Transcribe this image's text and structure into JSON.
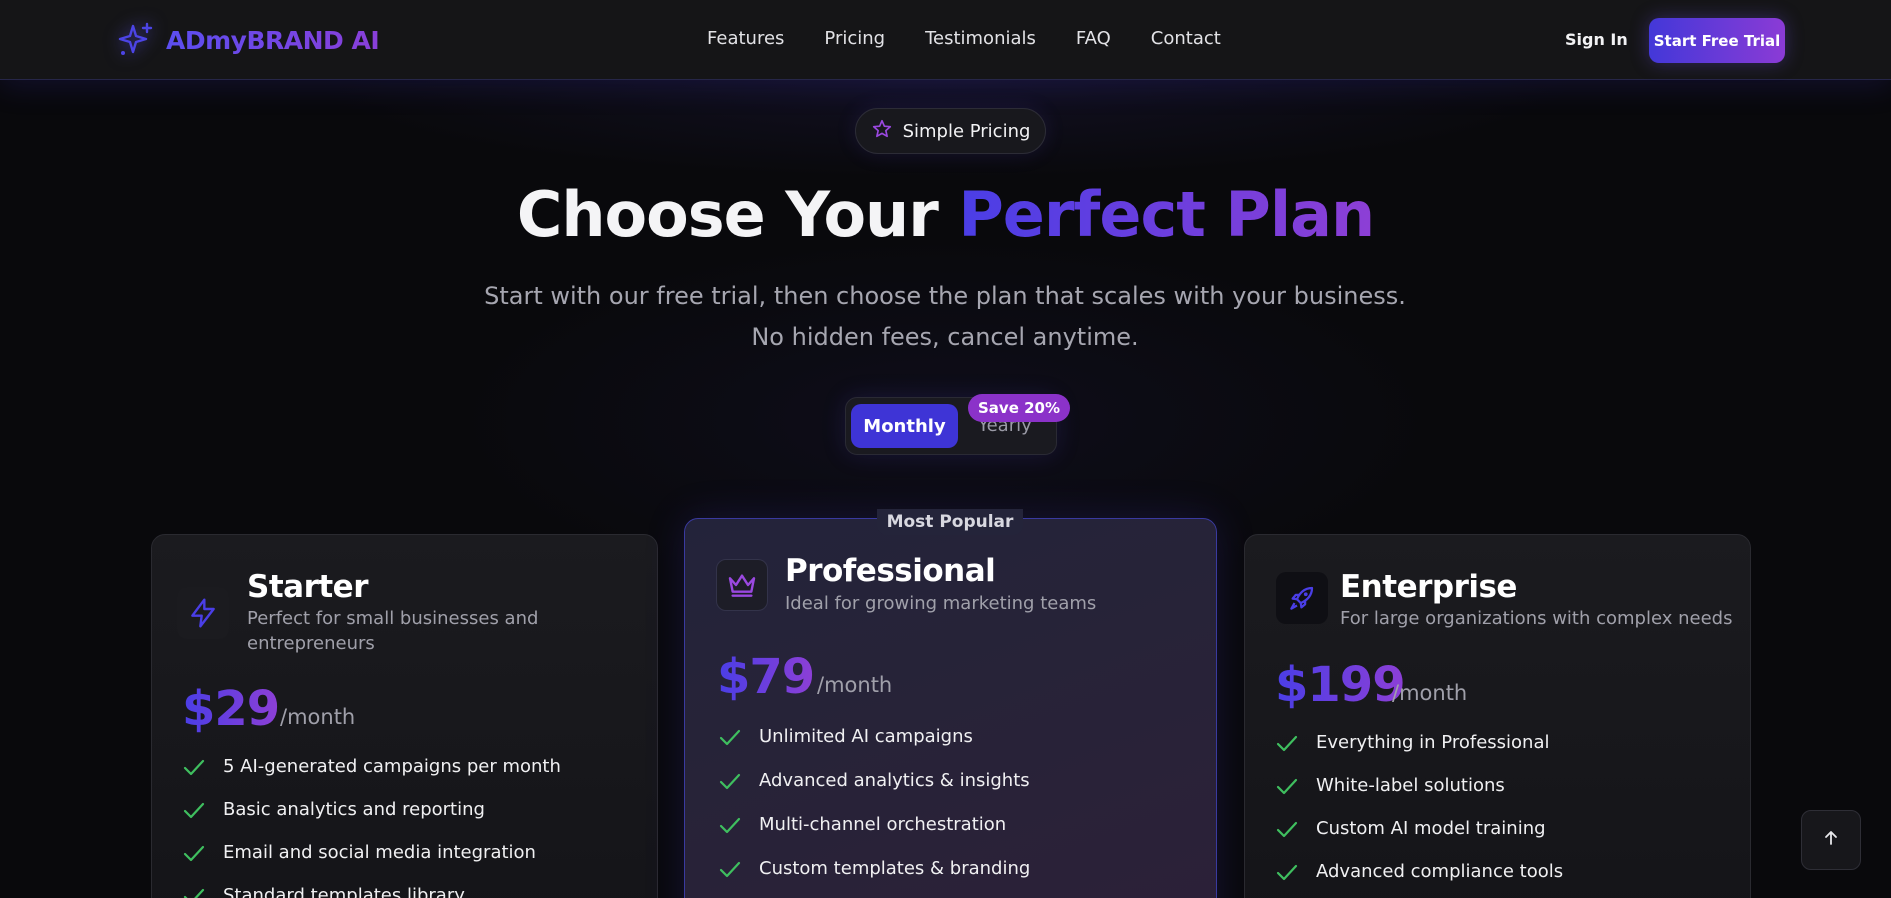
{
  "brand": {
    "name": "ADmyBRAND AI",
    "icon": "sparkles-icon"
  },
  "nav": {
    "links": [
      "Features",
      "Pricing",
      "Testimonials",
      "FAQ",
      "Contact"
    ],
    "sign_in": "Sign In",
    "cta": "Start Free Trial"
  },
  "hero": {
    "pill_label": "Simple Pricing",
    "pill_icon": "star-icon",
    "title_plain": "Choose Your ",
    "title_highlight": "Perfect Plan",
    "subtitle": "Start with our free trial, then choose the plan that scales with your business. No hidden fees, cancel anytime."
  },
  "billing_toggle": {
    "monthly": "Monthly",
    "yearly": "Yearly",
    "selected": "Monthly",
    "save_badge": "Save 20%"
  },
  "plans": [
    {
      "name": "Starter",
      "icon": "lightning-icon",
      "description": "Perfect for small businesses and entrepreneurs",
      "price": "$29",
      "period": "/month",
      "features": [
        "5 AI-generated campaigns per month",
        "Basic analytics and reporting",
        "Email and social media integration",
        "Standard templates library"
      ]
    },
    {
      "name": "Professional",
      "icon": "crown-icon",
      "badge": "Most Popular",
      "description": "Ideal for growing marketing teams",
      "price": "$79",
      "period": "/month",
      "features": [
        "Unlimited AI campaigns",
        "Advanced analytics & insights",
        "Multi-channel orchestration",
        "Custom templates & branding"
      ]
    },
    {
      "name": "Enterprise",
      "icon": "rocket-icon",
      "description": "For large organizations with complex needs",
      "price": "$199",
      "period": "/month",
      "features": [
        "Everything in Professional",
        "White-label solutions",
        "Custom AI model training",
        "Advanced compliance tools"
      ]
    }
  ],
  "colors": {
    "accent_start": "#4a3ee6",
    "accent_end": "#8d3fd6",
    "check": "#3fbf5f",
    "background": "#09090c"
  },
  "scroll_top_icon": "arrow-up-icon"
}
